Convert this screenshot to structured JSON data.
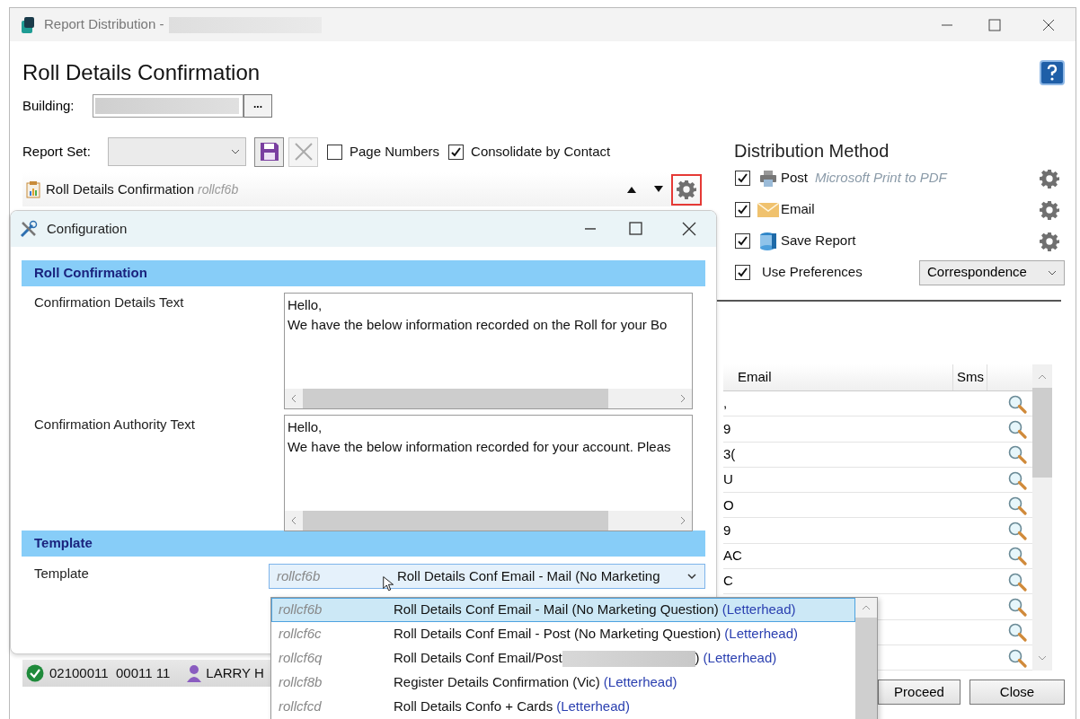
{
  "window": {
    "title": "Report Distribution -"
  },
  "heading": "Roll Details Confirmation",
  "building": {
    "label": "Building:",
    "browse_label": "..."
  },
  "report_set": {
    "label": "Report Set:"
  },
  "options": [
    {
      "label": "Page Numbers",
      "checked": false
    },
    {
      "label": "Consolidate by Contact",
      "checked": true
    }
  ],
  "report": {
    "name": "Roll Details Confirmation",
    "code": "rollcf6b",
    "settings_highlighted": true
  },
  "distribution": {
    "title": "Distribution Method",
    "methods": [
      {
        "kind": "post",
        "label": "Post",
        "detail": "Microsoft Print to PDF",
        "checked": true
      },
      {
        "kind": "email",
        "label": "Email",
        "checked": true
      },
      {
        "kind": "save",
        "label": "Save Report",
        "checked": true
      }
    ],
    "preferences": {
      "label": "Use Preferences",
      "checked": true,
      "value": "Correspondence"
    }
  },
  "grid": {
    "columns": [
      "Email",
      "Sms"
    ],
    "rows": [
      {
        "fragment": ","
      },
      {
        "fragment": "9"
      },
      {
        "fragment": "3("
      },
      {
        "fragment": "U"
      },
      {
        "fragment": "O"
      },
      {
        "fragment": "9"
      },
      {
        "fragment": "AC"
      },
      {
        "fragment": "C"
      },
      {},
      {},
      {}
    ]
  },
  "status_row": {
    "code": "02100011  00011 11",
    "name": "LARRY H"
  },
  "buttons": [
    "Proceed",
    "Close"
  ],
  "configuration": {
    "title": "Configuration",
    "sections": [
      {
        "title": "Roll Confirmation",
        "fields": [
          {
            "kind": "textarea",
            "label": "Confirmation Details Text",
            "lines": [
              "Hello,",
              "We have the below information recorded on the Roll for your Bo"
            ]
          },
          {
            "kind": "textarea",
            "label": "Confirmation Authority Text",
            "lines": [
              "Hello,",
              "We have the below information recorded for your account. Pleas"
            ]
          }
        ]
      },
      {
        "title": "Template",
        "fields": [
          {
            "kind": "combo",
            "label": "Template",
            "code": "rollcf6b",
            "value": "Roll Details Conf Email - Mail (No Marketing"
          }
        ]
      }
    ]
  },
  "template_options": [
    {
      "code": "rollcf6b",
      "name": "Roll Details Conf Email - Mail (No Marketing Question)",
      "suffix": "(Letterhead)",
      "selected": true
    },
    {
      "code": "rollcf6c",
      "name": "Roll Details Conf Email - Post (No Marketing Question)",
      "suffix": "(Letterhead)",
      "selected": false
    },
    {
      "code": "rollcf6q",
      "name": "Roll Details Conf Email/Post",
      "name_end": ")",
      "suffix": "(Letterhead)",
      "selected": false
    },
    {
      "code": "rollcf8b",
      "name": "Register Details Confirmation (Vic)",
      "suffix": "(Letterhead)",
      "selected": false
    },
    {
      "code": "rollcfcd",
      "name": "Roll Details Confo + Cards",
      "suffix": "(Letterhead)",
      "selected": false
    }
  ]
}
